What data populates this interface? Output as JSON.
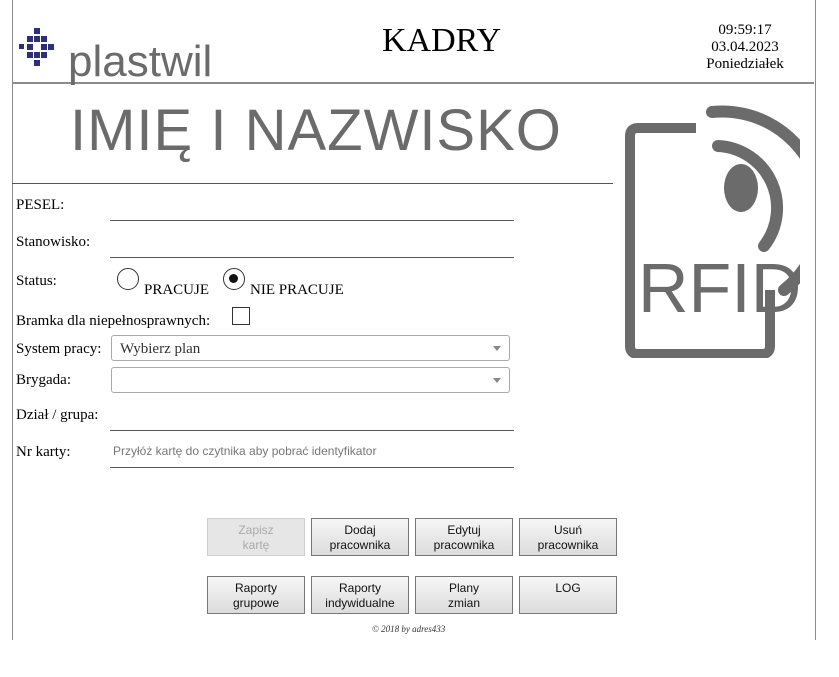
{
  "header": {
    "logo_text": "plastwil",
    "title": "KADRY",
    "time": "09:59:17",
    "date": "03.04.2023",
    "day": "Poniedziałek"
  },
  "employee": {
    "name_title": "IMIĘ I NAZWISKO"
  },
  "rfid_label": "RFID",
  "form": {
    "pesel_label": "PESEL:",
    "position_label": "Stanowisko:",
    "status_label": "Status:",
    "status_options": [
      "PRACUJE",
      "NIE PRACUJE"
    ],
    "status_selected": "NIE PRACUJE",
    "gate_label": "Bramka dla niepełnosprawnych:",
    "gate_checked": false,
    "work_system_label": "System pracy:",
    "work_system_value": "Wybierz plan",
    "brigade_label": "Brygada:",
    "brigade_value": "",
    "department_label": "Dział / grupa:",
    "card_label": "Nr karty:",
    "card_placeholder": "Przyłóż kartę do czytnika aby pobrać identyfikator"
  },
  "buttons": {
    "save_card": [
      "Zapisz",
      "kartę"
    ],
    "add_employee": [
      "Dodaj",
      "pracownika"
    ],
    "edit_employee": [
      "Edytuj",
      "pracownika"
    ],
    "delete_employee": [
      "Usuń",
      "pracownika"
    ],
    "group_reports": [
      "Raporty",
      "grupowe"
    ],
    "individual_reports": [
      "Raporty",
      "indywidualne"
    ],
    "shift_plans": [
      "Plany",
      "zmian"
    ],
    "log": [
      "LOG"
    ]
  },
  "footer": {
    "copyright": "© 2018 by adres433"
  },
  "colors": {
    "logo_gray": "#6b6b6b",
    "logo_blue": "#2e2f7a",
    "rule_gray": "#8c8c8c"
  }
}
